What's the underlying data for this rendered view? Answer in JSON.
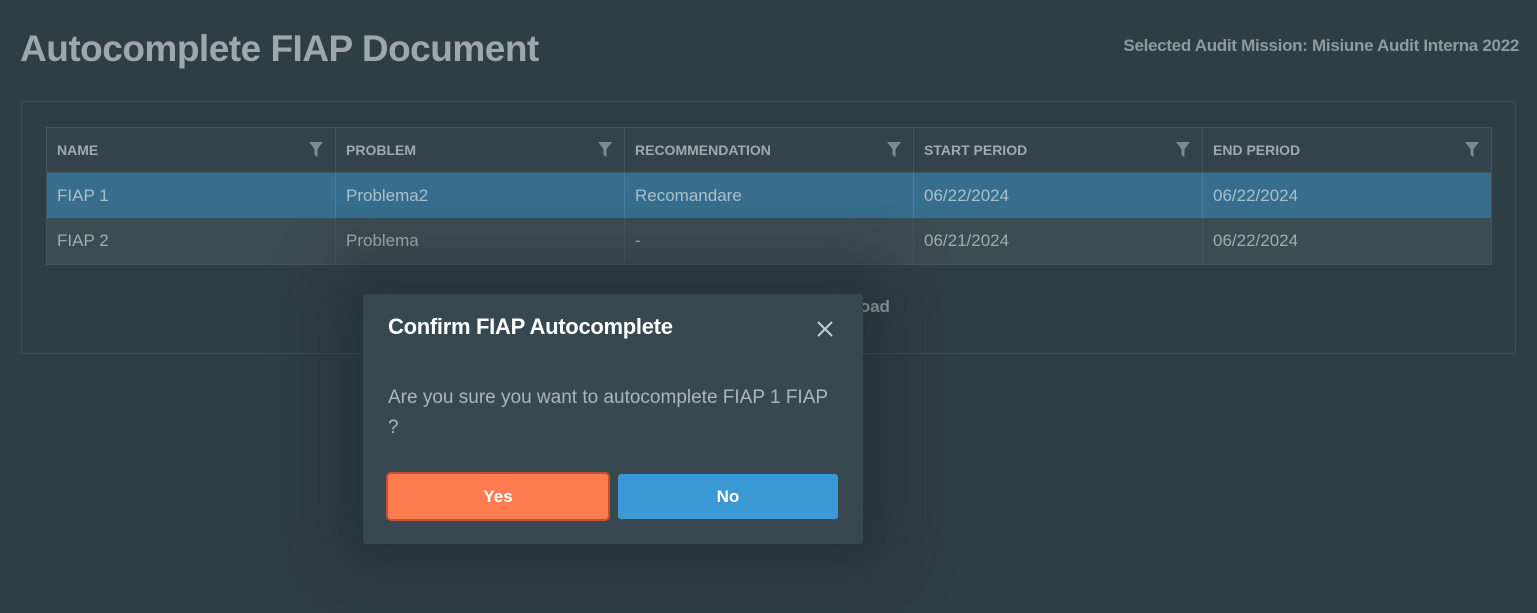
{
  "page": {
    "title": "Autocomplete FIAP Document",
    "mission_label": "Selected Audit Mission: Misiune Audit Interna 2022"
  },
  "table": {
    "columns": [
      "NAME",
      "PROBLEM",
      "RECOMMENDATION",
      "START PERIOD",
      "END PERIOD"
    ],
    "rows": [
      [
        "FIAP 1",
        "Problema2",
        "Recomandare",
        "06/22/2024",
        "06/22/2024"
      ],
      [
        "FIAP 2",
        "Problema",
        "-",
        "06/21/2024",
        "06/22/2024"
      ]
    ],
    "selected_row": "FIAP 1"
  },
  "download": {
    "partial_label": "load"
  },
  "modal": {
    "title": "Confirm FIAP Autocomplete",
    "message": "Are you sure you want to autocomplete FIAP 1 FIAP ?",
    "yes_label": "Yes",
    "no_label": "No",
    "close_icon": "close-icon"
  },
  "colors": {
    "background": "#2f3d45",
    "selected_row": "#376e8d",
    "alt_row": "#3d4b52",
    "yes_button": "#ff7b50",
    "no_button": "#3b9ad6",
    "modal_bg": "#384850"
  },
  "icons": {
    "column_filter": "filter-icon"
  }
}
